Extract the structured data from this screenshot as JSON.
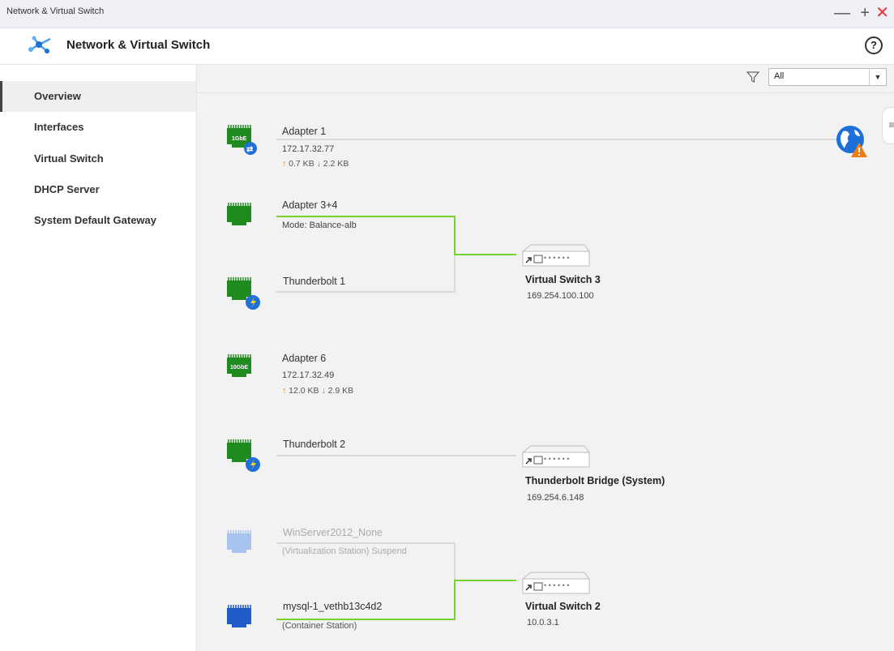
{
  "window": {
    "title": "Network & Virtual Switch"
  },
  "app": {
    "title": "Network & Virtual Switch",
    "help": "?"
  },
  "controls": {
    "minimize": "—",
    "maximize": "+",
    "close": "✕"
  },
  "sidebar": {
    "items": [
      {
        "label": "Overview"
      },
      {
        "label": "Interfaces"
      },
      {
        "label": "Virtual Switch"
      },
      {
        "label": "DHCP Server"
      },
      {
        "label": "System Default Gateway"
      }
    ]
  },
  "filter": {
    "selected": "All",
    "arrow": "▼"
  },
  "side_handle": "≡",
  "interfaces": {
    "adapter1": {
      "name": "Adapter 1",
      "ip": "172.17.32.77",
      "badge": "1GbE",
      "up": "0.7 KB",
      "down": "2.2 KB",
      "up_icon": "↑",
      "down_icon": "↓"
    },
    "adapter34": {
      "name": "Adapter 3+4",
      "mode": "Mode: Balance-alb"
    },
    "tb1": {
      "name": "Thunderbolt 1"
    },
    "adapter6": {
      "name": "Adapter 6",
      "ip": "172.17.32.49",
      "badge": "10GbE",
      "up": "12.0 KB",
      "down": "2.9 KB",
      "up_icon": "↑",
      "down_icon": "↓"
    },
    "tb2": {
      "name": "Thunderbolt 2"
    },
    "winserver": {
      "name": "WinServer2012_None",
      "sub": "(Virtualization Station) Suspend"
    },
    "mysql": {
      "name": "mysql-1_vethb13c4d2",
      "sub": "(Container Station)"
    }
  },
  "switches": {
    "vs3": {
      "name": "Virtual Switch 3",
      "ip": "169.254.100.100"
    },
    "tbb": {
      "name": "Thunderbolt Bridge (System)",
      "ip": "169.254.6.148"
    },
    "vs2": {
      "name": "Virtual Switch 2",
      "ip": "10.0.3.1"
    }
  },
  "colors": {
    "port_green": "#1f8a1f",
    "link_green": "#77d12e",
    "line_gray": "#cccccc",
    "port_blue": "#1f5bc9",
    "port_faded": "#a8c4ee"
  }
}
